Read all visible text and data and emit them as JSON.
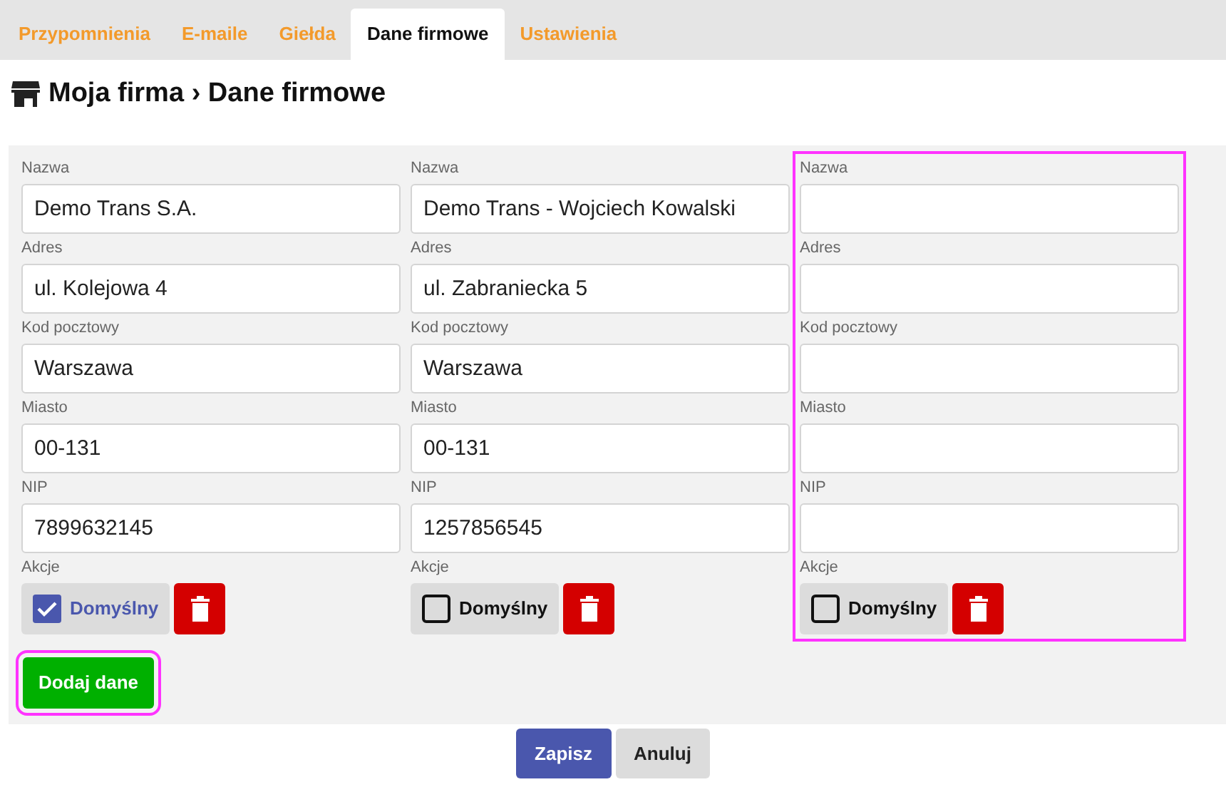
{
  "tabs": [
    {
      "label": "Przypomnienia",
      "selected": false
    },
    {
      "label": "E-maile",
      "selected": false
    },
    {
      "label": "Giełda",
      "selected": false
    },
    {
      "label": "Dane firmowe",
      "selected": true
    },
    {
      "label": "Ustawienia",
      "selected": false
    }
  ],
  "breadcrumb": {
    "parent": "Moja firma",
    "separator": "›",
    "current": "Dane firmowe"
  },
  "companies": [
    {
      "highlighted": false,
      "fields": [
        {
          "label": "Nazwa",
          "value": "Demo Trans S.A."
        },
        {
          "label": "Adres",
          "value": "ul. Kolejowa 4"
        },
        {
          "label": "Kod pocztowy",
          "value": "Warszawa"
        },
        {
          "label": "Miasto",
          "value": "00-131"
        },
        {
          "label": "NIP",
          "value": "7899632145"
        }
      ],
      "actions_label": "Akcje",
      "default": {
        "label": "Domyślny",
        "checked": true
      }
    },
    {
      "highlighted": false,
      "fields": [
        {
          "label": "Nazwa",
          "value": "Demo Trans - Wojciech Kowalski"
        },
        {
          "label": "Adres",
          "value": "ul. Zabraniecka 5"
        },
        {
          "label": "Kod pocztowy",
          "value": "Warszawa"
        },
        {
          "label": "Miasto",
          "value": "00-131"
        },
        {
          "label": "NIP",
          "value": "1257856545"
        }
      ],
      "actions_label": "Akcje",
      "default": {
        "label": "Domyślny",
        "checked": false
      }
    },
    {
      "highlighted": true,
      "fields": [
        {
          "label": "Nazwa"
        },
        {
          "label": "Adres"
        },
        {
          "label": "Kod pocztowy"
        },
        {
          "label": "Miasto"
        },
        {
          "label": "NIP"
        }
      ],
      "actions_label": "Akcje",
      "default": {
        "label": "Domyślny",
        "checked": false
      }
    }
  ],
  "add_button": {
    "label": "Dodaj dane",
    "highlighted": true
  },
  "footer_buttons": [
    {
      "label": "Zapisz",
      "kind": "primary"
    },
    {
      "label": "Anuluj",
      "kind": "secondary"
    }
  ]
}
